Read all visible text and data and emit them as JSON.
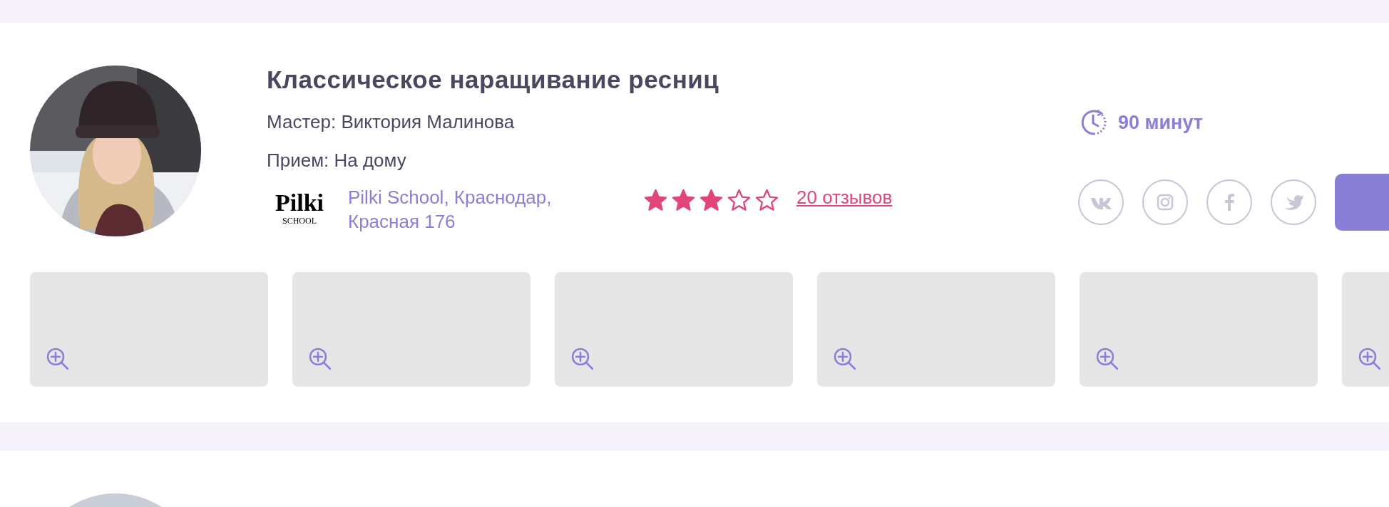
{
  "card": {
    "title": "Классическое наращивание ресниц",
    "master": "Мастер: Виктория Малинова",
    "reception": "Прием: На дому",
    "logo": {
      "name": "Pilki",
      "sub": "SCHOOL"
    },
    "address": "Pilki School, Краснодар, Красная 176",
    "rating": {
      "stars": 3
    },
    "reviews": "20 отзывов",
    "duration": "90 минут"
  }
}
